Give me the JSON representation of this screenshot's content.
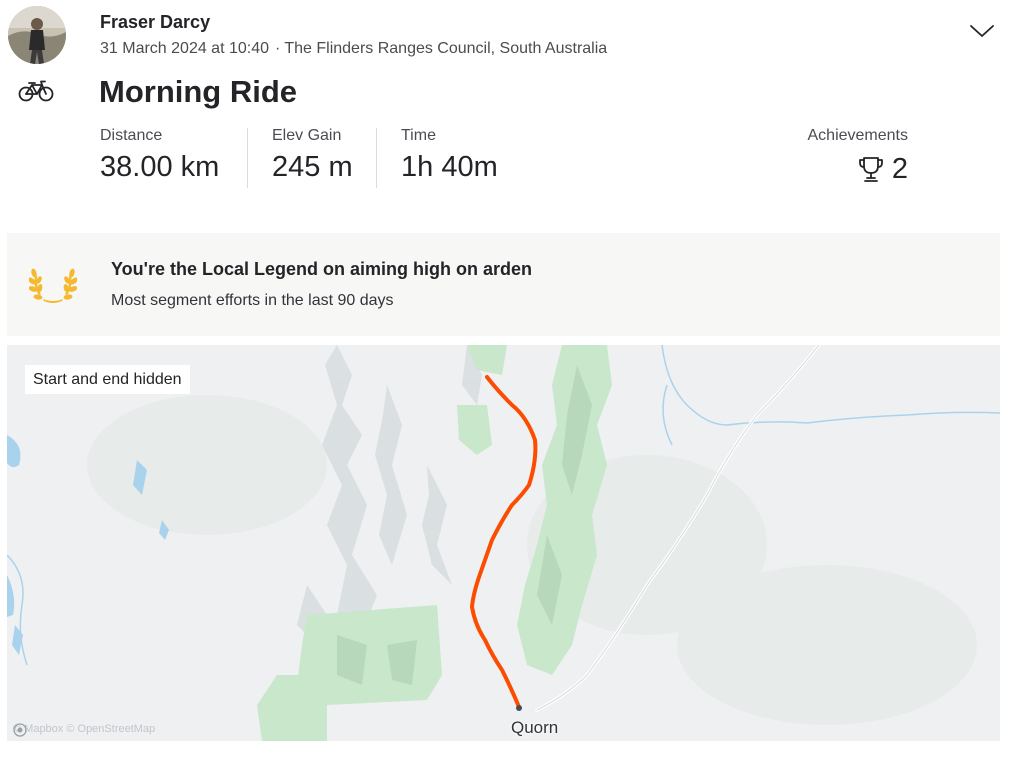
{
  "activity": {
    "athlete_name": "Fraser Darcy",
    "date_time": "31 March 2024 at 10:40",
    "location": "The Flinders Ranges Council, South Australia",
    "meta_separator": "·",
    "title": "Morning Ride",
    "sport_icon": "bicycle-icon"
  },
  "stats": [
    {
      "label": "Distance",
      "value": "38.00 km"
    },
    {
      "label": "Elev Gain",
      "value": "245 m"
    },
    {
      "label": "Time",
      "value": "1h 40m"
    }
  ],
  "achievements": {
    "label": "Achievements",
    "count": "2",
    "icon": "trophy-icon"
  },
  "local_legend": {
    "title": "You're the Local Legend on aiming high on arden",
    "subtitle": "Most segment efforts in the last 90 days",
    "icon": "laurel-wreath-icon"
  },
  "map": {
    "privacy_badge": "Start and end hidden",
    "town_label": "Quorn",
    "attribution": "© Mapbox © OpenStreetMap",
    "route_color": "#fc4c02",
    "park_color": "#c6e6c6"
  }
}
